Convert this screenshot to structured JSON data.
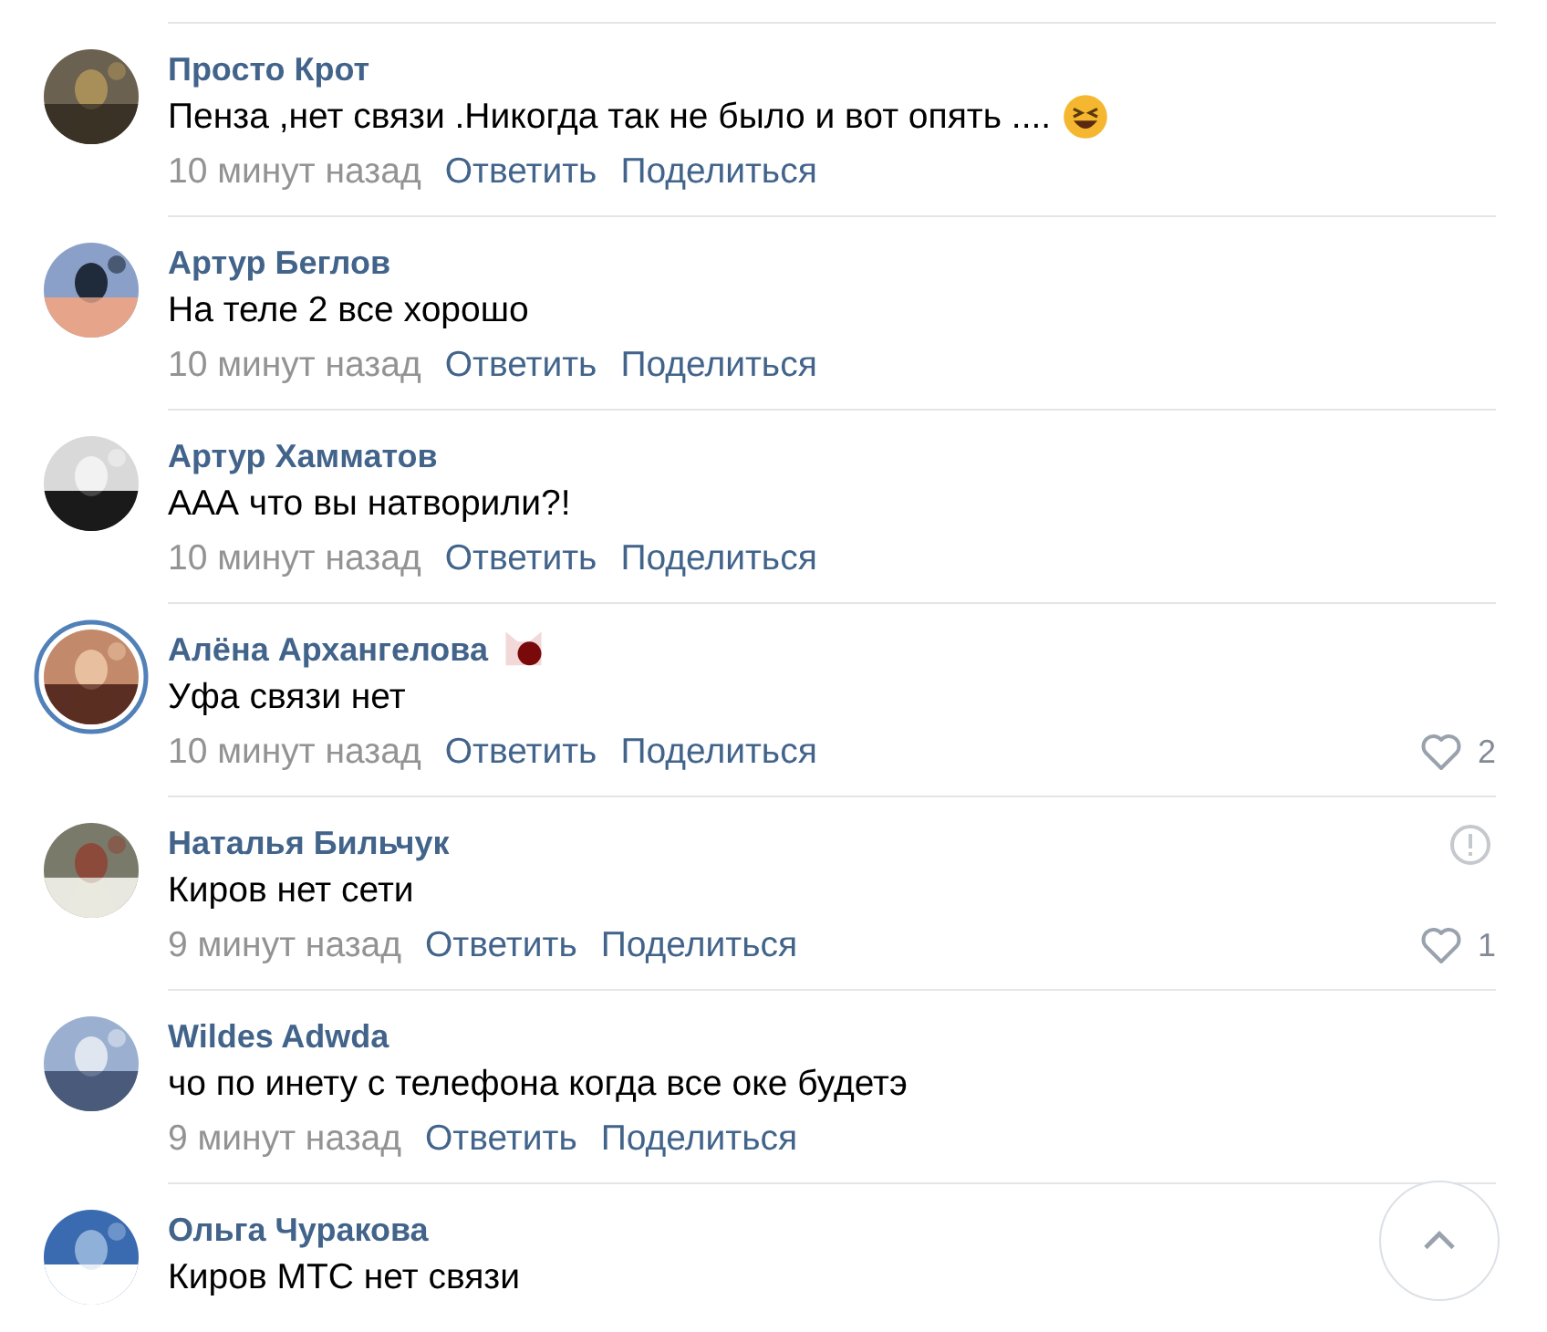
{
  "comments": [
    {
      "author": "Просто Крот",
      "text": "Пенза ,нет связи .Никогда так не было и вот опять ....",
      "emoji": true,
      "name_badge": false,
      "ringed": false,
      "report": false,
      "time": "10 минут назад",
      "reply": "Ответить",
      "share": "Поделиться"
    },
    {
      "author": "Артур Беглов",
      "text": "На теле 2 все хорошо",
      "emoji": false,
      "name_badge": false,
      "ringed": false,
      "report": false,
      "time": "10 минут назад",
      "reply": "Ответить",
      "share": "Поделиться"
    },
    {
      "author": "Артур Хамматов",
      "text": "ААА что вы натворили?!",
      "emoji": false,
      "name_badge": false,
      "ringed": false,
      "report": false,
      "time": "10 минут назад",
      "reply": "Ответить",
      "share": "Поделиться"
    },
    {
      "author": "Алёна Архангелова",
      "text": "Уфа связи нет",
      "emoji": false,
      "name_badge": true,
      "ringed": true,
      "report": false,
      "time": "10 минут назад",
      "reply": "Ответить",
      "share": "Поделиться",
      "likes": "2"
    },
    {
      "author": "Наталья Бильчук",
      "text": "Киров нет сети",
      "emoji": false,
      "name_badge": false,
      "ringed": false,
      "report": true,
      "time": "9 минут назад",
      "reply": "Ответить",
      "share": "Поделиться",
      "likes": "1"
    },
    {
      "author": "Wildes Adwda",
      "text": "чо по инету с телефона когда все оке будетэ",
      "emoji": false,
      "name_badge": false,
      "ringed": false,
      "report": false,
      "time": "9 минут назад",
      "reply": "Ответить",
      "share": "Поделиться"
    },
    {
      "author": "Ольга Чуракова",
      "text": "Киров МТС нет связи",
      "emoji": false,
      "name_badge": false,
      "ringed": false,
      "report": false
    }
  ],
  "scroll_top_button": true
}
